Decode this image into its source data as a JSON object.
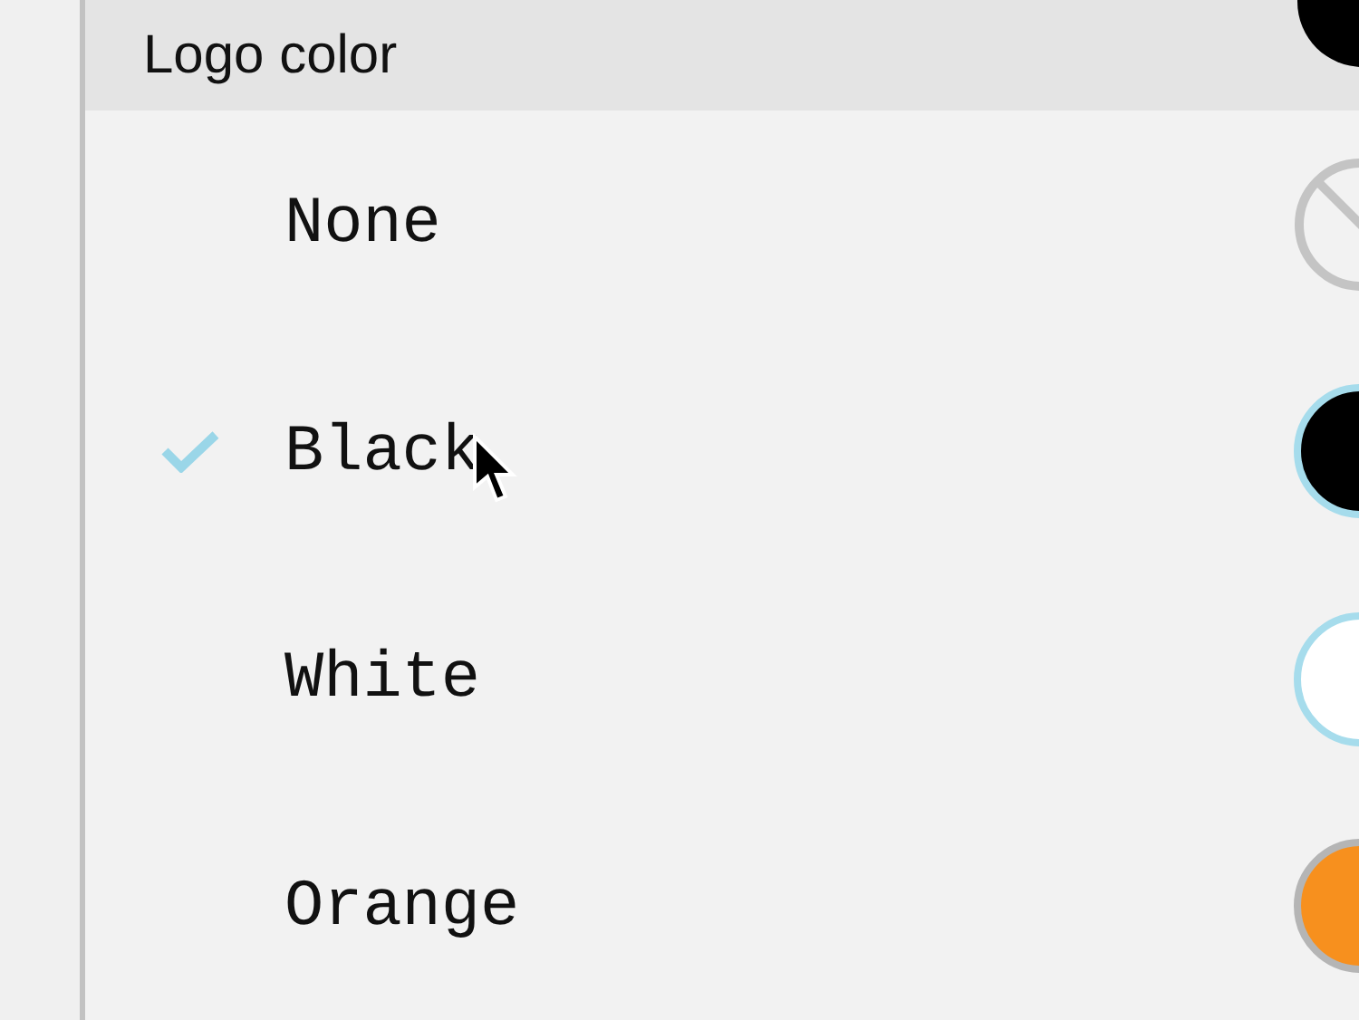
{
  "header": {
    "title": "Logo color",
    "color": "#000000"
  },
  "options": [
    {
      "label": "None",
      "kind": "none",
      "selected": false,
      "highlighted": false
    },
    {
      "label": "Black",
      "kind": "swatch",
      "color": "#000000",
      "selected": true,
      "highlighted": false
    },
    {
      "label": "White",
      "kind": "swatch",
      "color": "#ffffff",
      "selected": false,
      "highlighted": true
    },
    {
      "label": "Orange",
      "kind": "swatch",
      "color": "#f7901e",
      "selected": false,
      "highlighted": false
    }
  ]
}
